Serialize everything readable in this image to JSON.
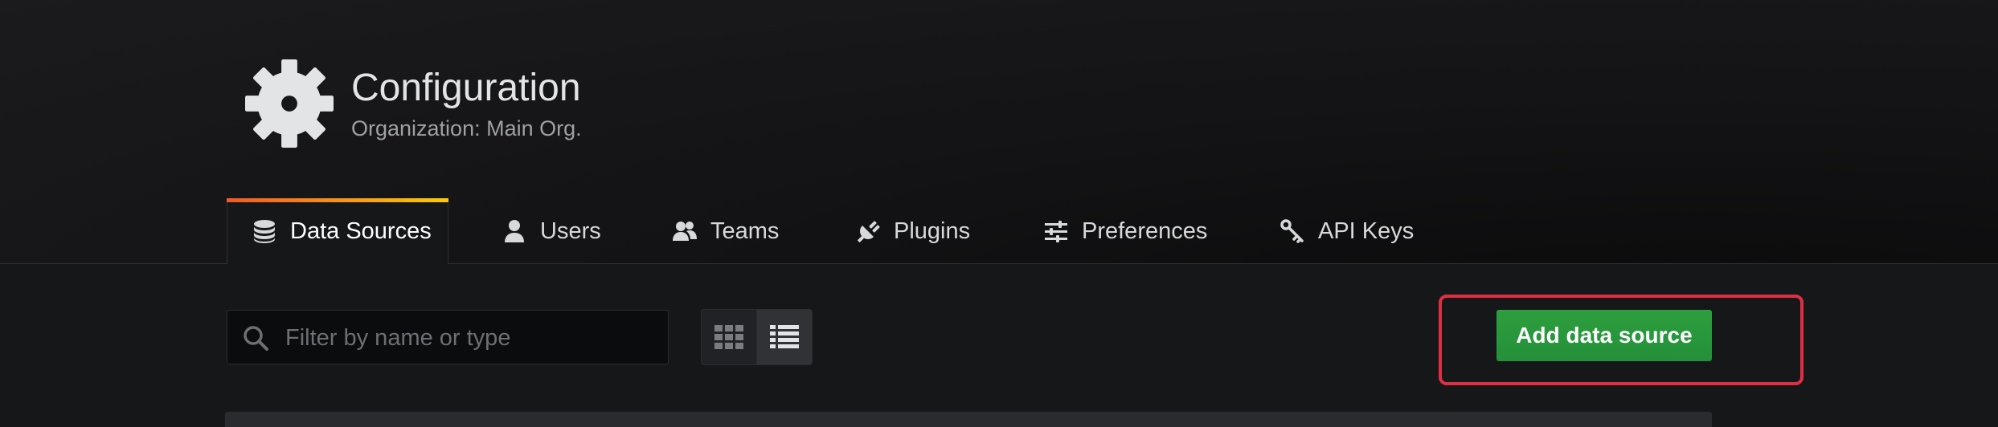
{
  "header": {
    "icon": "gear-icon",
    "title": "Configuration",
    "subtitle": "Organization: Main Org."
  },
  "tabs": [
    {
      "label": "Data Sources",
      "icon": "database-icon",
      "active": true
    },
    {
      "label": "Users",
      "icon": "user-icon",
      "active": false
    },
    {
      "label": "Teams",
      "icon": "users-icon",
      "active": false
    },
    {
      "label": "Plugins",
      "icon": "plug-icon",
      "active": false
    },
    {
      "label": "Preferences",
      "icon": "sliders-icon",
      "active": false
    },
    {
      "label": "API Keys",
      "icon": "key-icon",
      "active": false
    }
  ],
  "toolbar": {
    "search_placeholder": "Filter by name or type",
    "search_value": "",
    "view_modes": [
      "grid",
      "list"
    ],
    "active_view": "list",
    "add_label": "Add data source"
  },
  "colors": {
    "accent_gradient": [
      "#f05a28",
      "#fbca0a"
    ],
    "primary_button": "#299c46",
    "highlight": "#e02f44"
  }
}
